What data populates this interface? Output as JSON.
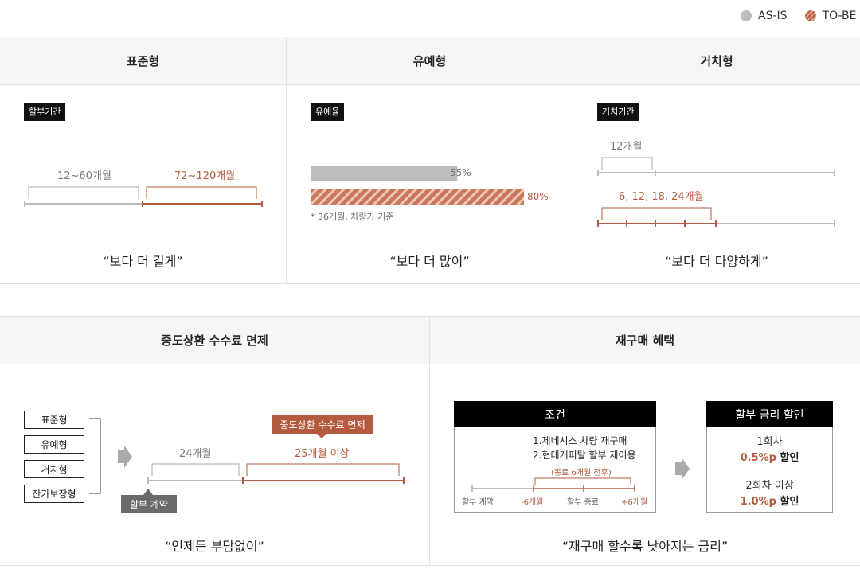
{
  "legend": {
    "asis": "AS-IS",
    "tobe": "TO-BE"
  },
  "colors": {
    "accent": "#b55a3e",
    "asis_gray": "#bdbdbd",
    "dark": "#111111"
  },
  "section1": {
    "standard": {
      "header": "표준형",
      "tag": "할부기간",
      "asis_label": "12~60개월",
      "tobe_label": "72~120개월",
      "quote": "“보다 더 길게”"
    },
    "deferred": {
      "header": "유예형",
      "tag": "유예율",
      "asis_label": "55%",
      "tobe_label": "80%",
      "asis_rate": 55,
      "tobe_rate": 80,
      "note": "*  36개월, 차량가 기준",
      "quote": "“보다 더 많이”"
    },
    "grace": {
      "header": "거치형",
      "tag": "거치기간",
      "asis_label": "12개월",
      "tobe_label": "6, 12, 18, 24개월",
      "quote": "“보다 더 다양하게”"
    }
  },
  "section2": {
    "prepay": {
      "header": "중도상환 수수료 면제",
      "types": [
        "표준형",
        "유예형",
        "거치형",
        "잔가보장형"
      ],
      "asis_label": "24개월",
      "tobe_tag": "중도상환 수수료 면제",
      "tobe_label": "25개월 이상",
      "contract_tag": "할부 계약",
      "quote": "“언제든 부담없이”"
    },
    "repurchase": {
      "header": "재구매 혜택",
      "cond_title": "조건",
      "cond_lines": [
        "1.제네시스 차량 재구매",
        "2.현대캐피탈 할부 재이용"
      ],
      "cond_range": "(종료 6개월 전후)",
      "timeline": [
        "할부 계약",
        "-6개월",
        "할부 종료",
        "+6개월"
      ],
      "discount_title": "할부 금리 할인",
      "first_label": "1회차",
      "first_value": "0.5%p",
      "first_suffix": "할인",
      "second_label": "2회차 이상",
      "second_value": "1.0%p",
      "second_suffix": "할인",
      "quote": "“재구매 할수록 낮아지는 금리”"
    }
  }
}
